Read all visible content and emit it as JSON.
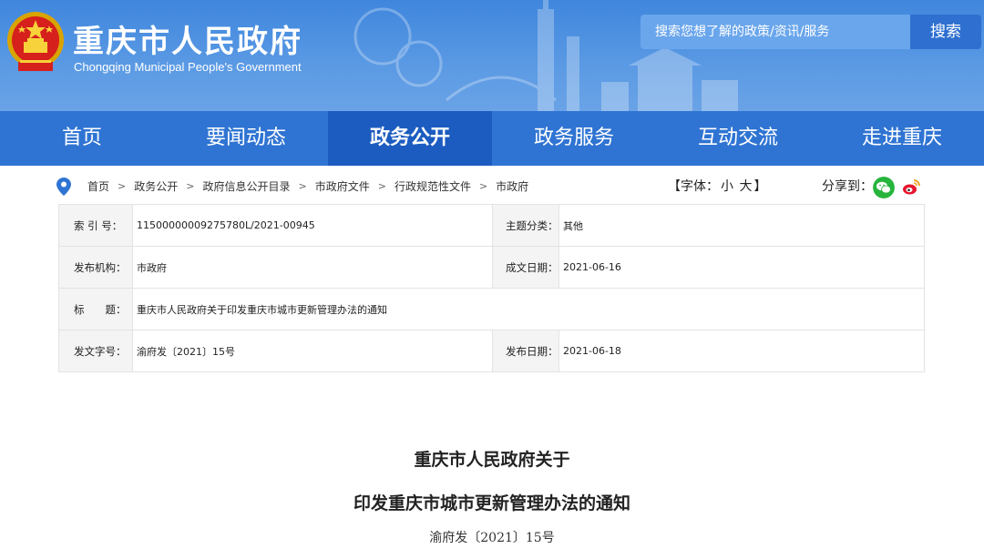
{
  "header": {
    "title": "重庆市人民政府",
    "subtitle": "Chongqing Municipal People's Government",
    "emblem_icon": "national-emblem-icon",
    "search": {
      "placeholder": "搜索您想了解的政策/资讯/服务",
      "button": "搜索"
    }
  },
  "nav": {
    "items": [
      {
        "label": "首页",
        "active": false
      },
      {
        "label": "要闻动态",
        "active": false
      },
      {
        "label": "政务公开",
        "active": true
      },
      {
        "label": "政务服务",
        "active": false
      },
      {
        "label": "互动交流",
        "active": false
      },
      {
        "label": "走进重庆",
        "active": false
      }
    ]
  },
  "breadcrumb": {
    "icon": "location-pin-icon",
    "items": [
      "首页",
      "政务公开",
      "政府信息公开目录",
      "市政府文件",
      "行政规范性文件",
      "市政府"
    ],
    "separator": ">"
  },
  "font_size": {
    "prefix": "【字体：",
    "small": "小",
    "large": "大",
    "suffix": "】"
  },
  "share": {
    "label": "分享到：",
    "icons": [
      "wechat-icon",
      "weibo-icon"
    ]
  },
  "info_table": {
    "index_label": "索 引 号：",
    "index_value": "11500000009275780L/2021-00945",
    "topic_label": "主题分类：",
    "topic_value": "其他",
    "issuer_label": "发布机构：",
    "issuer_value": "市政府",
    "written_date_label": "成文日期：",
    "written_date_value": "2021-06-16",
    "title_label": "标　　题：",
    "title_value": "重庆市人民政府关于印发重庆市城市更新管理办法的通知",
    "doc_no_label": "发文字号：",
    "doc_no_value": "渝府发〔2021〕15号",
    "publish_date_label": "发布日期：",
    "publish_date_value": "2021-06-18"
  },
  "document": {
    "title_line1": "重庆市人民政府关于",
    "title_line2": "印发重庆市城市更新管理办法的通知",
    "number": "渝府发〔2021〕15号"
  },
  "colors": {
    "header_blue": "#4a8fe0",
    "nav_blue": "#2f74d3",
    "nav_active": "#1c5cc0",
    "wechat": "#27b53d",
    "weibo": "#e6162d"
  }
}
